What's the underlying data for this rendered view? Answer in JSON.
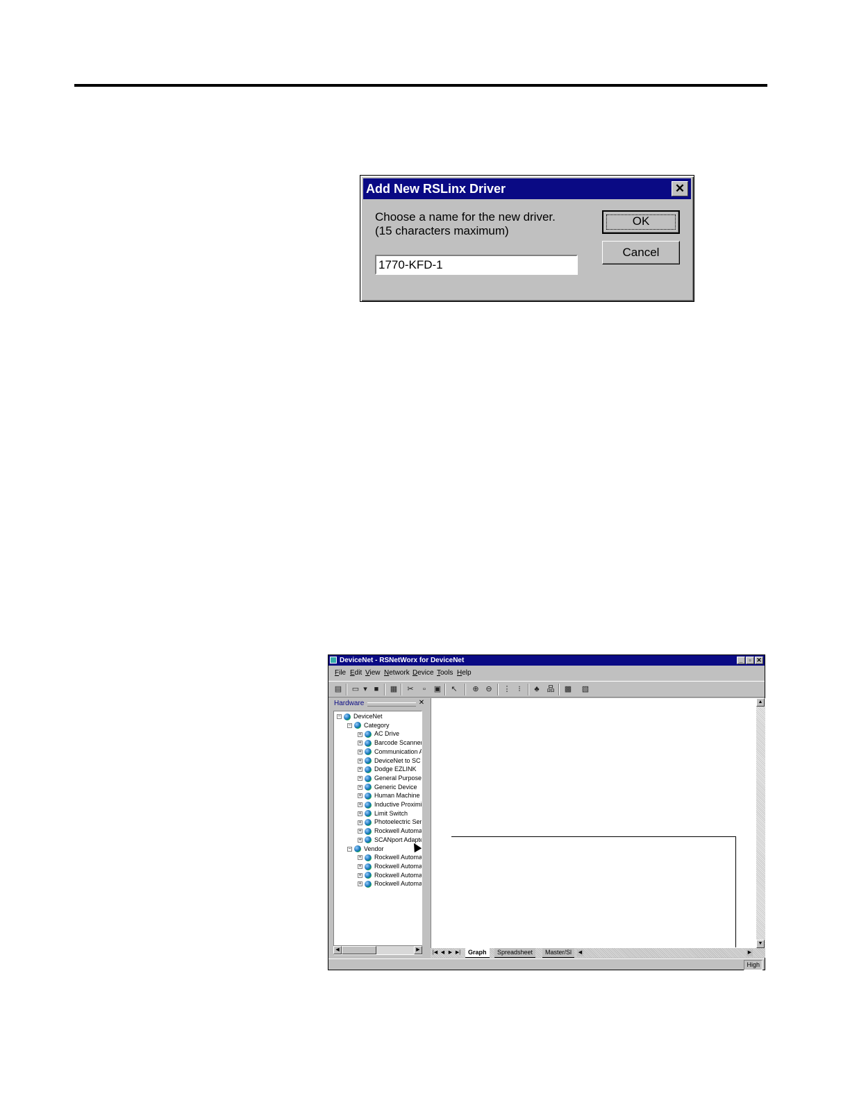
{
  "dialog": {
    "title": "Add New RSLinx Driver",
    "close_glyph": "✕",
    "prompt_line1": "Choose a name for the new driver.",
    "prompt_line2": "(15 characters maximum)",
    "input_value": "1770-KFD-1",
    "ok_label": "OK",
    "cancel_label": "Cancel"
  },
  "app": {
    "title": "DeviceNet - RSNetWorx for DeviceNet",
    "window_buttons": [
      "_",
      "▫",
      "✕"
    ],
    "menu": [
      "File",
      "Edit",
      "View",
      "Network",
      "Device",
      "Tools",
      "Help"
    ],
    "hardware_label": "Hardware",
    "tree": [
      {
        "label": "DeviceNet",
        "level": 0,
        "toggle": "−"
      },
      {
        "label": "Category",
        "level": 1,
        "toggle": "−"
      },
      {
        "label": "AC Drive",
        "level": 2,
        "toggle": "+"
      },
      {
        "label": "Barcode Scanner",
        "level": 2,
        "toggle": "+"
      },
      {
        "label": "Communication A",
        "level": 2,
        "toggle": "+"
      },
      {
        "label": "DeviceNet to SC",
        "level": 2,
        "toggle": "+"
      },
      {
        "label": "Dodge EZLINK",
        "level": 2,
        "toggle": "+"
      },
      {
        "label": "General Purpose",
        "level": 2,
        "toggle": "+"
      },
      {
        "label": "Generic Device",
        "level": 2,
        "toggle": "+"
      },
      {
        "label": "Human Machine",
        "level": 2,
        "toggle": "+"
      },
      {
        "label": "Inductive Proximit",
        "level": 2,
        "toggle": "+"
      },
      {
        "label": "Limit Switch",
        "level": 2,
        "toggle": "+"
      },
      {
        "label": "Photoelectric Ser",
        "level": 2,
        "toggle": "+"
      },
      {
        "label": "Rockwell Automa",
        "level": 2,
        "toggle": "+"
      },
      {
        "label": "SCANport Adapte",
        "level": 2,
        "toggle": "+"
      },
      {
        "label": "Vendor",
        "level": 1,
        "toggle": "−"
      },
      {
        "label": "Rockwell Automa",
        "level": 2,
        "toggle": "+"
      },
      {
        "label": "Rockwell Automa",
        "level": 2,
        "toggle": "+"
      },
      {
        "label": "Rockwell Automa",
        "level": 2,
        "toggle": "+"
      },
      {
        "label": "Rockwell Automa",
        "level": 2,
        "toggle": "+"
      }
    ],
    "tabs": [
      "Graph",
      "Spreadsheet",
      "Master/Sl"
    ],
    "active_tab": "Graph",
    "status_right": "High"
  },
  "colors": {
    "title_bar": "#0a0a84",
    "chrome": "#c0c0c0"
  }
}
